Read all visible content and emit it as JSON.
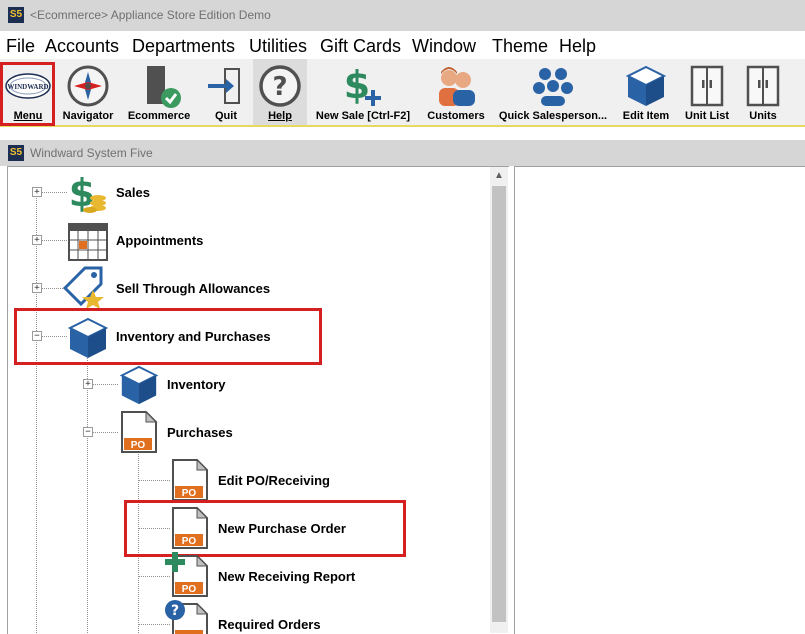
{
  "window": {
    "title": "<Ecommerce> Appliance Store Edition Demo",
    "app_icon_text": "S5"
  },
  "menubar": [
    "File",
    "Accounts",
    "Departments",
    "Utilities",
    "Gift Cards",
    "Window",
    "Theme",
    "Help"
  ],
  "toolbar": {
    "buttons": [
      {
        "label": "Menu",
        "icon": "windward-logo-icon",
        "logo_text": "WINDWARD"
      },
      {
        "label": "Navigator",
        "icon": "compass-icon"
      },
      {
        "label": "Ecommerce",
        "icon": "ecommerce-icon"
      },
      {
        "label": "Quit",
        "icon": "exit-door-icon"
      },
      {
        "label": "Help",
        "icon": "help-question-icon"
      },
      {
        "label": "New Sale [Ctrl-F2]",
        "icon": "dollar-plus-icon"
      },
      {
        "label": "Customers",
        "icon": "customers-icon"
      },
      {
        "label": "Quick Salesperson...",
        "icon": "salesperson-group-icon"
      },
      {
        "label": "Edit Item",
        "icon": "cube-icon"
      },
      {
        "label": "Unit List",
        "icon": "cabinet-icon"
      },
      {
        "label": "Units",
        "icon": "cabinet-icon"
      }
    ]
  },
  "subwindow": {
    "title": "Windward System Five"
  },
  "tree": {
    "nodes": [
      {
        "label": "Sales",
        "icon": "dollar-coins-icon",
        "expanded": false
      },
      {
        "label": "Appointments",
        "icon": "calendar-icon",
        "expanded": false
      },
      {
        "label": "Sell Through Allowances",
        "icon": "tag-star-icon",
        "expanded": false
      },
      {
        "label": "Inventory and Purchases",
        "icon": "cube-icon",
        "expanded": true
      },
      {
        "label": "Inventory",
        "icon": "cube-icon",
        "expanded": false
      },
      {
        "label": "Purchases",
        "icon": "po-document-icon",
        "expanded": true
      },
      {
        "label": "Edit PO/Receiving",
        "icon": "po-document-icon"
      },
      {
        "label": "New Purchase Order",
        "icon": "po-document-icon"
      },
      {
        "label": "New Receiving Report",
        "icon": "po-document-plus-icon"
      },
      {
        "label": "Required Orders",
        "icon": "po-document-question-icon"
      }
    ],
    "po_badge": "PO"
  },
  "colors": {
    "highlight": "#d42020",
    "accent_blue": "#2a62a6",
    "dollar_green": "#2d8a5e"
  }
}
